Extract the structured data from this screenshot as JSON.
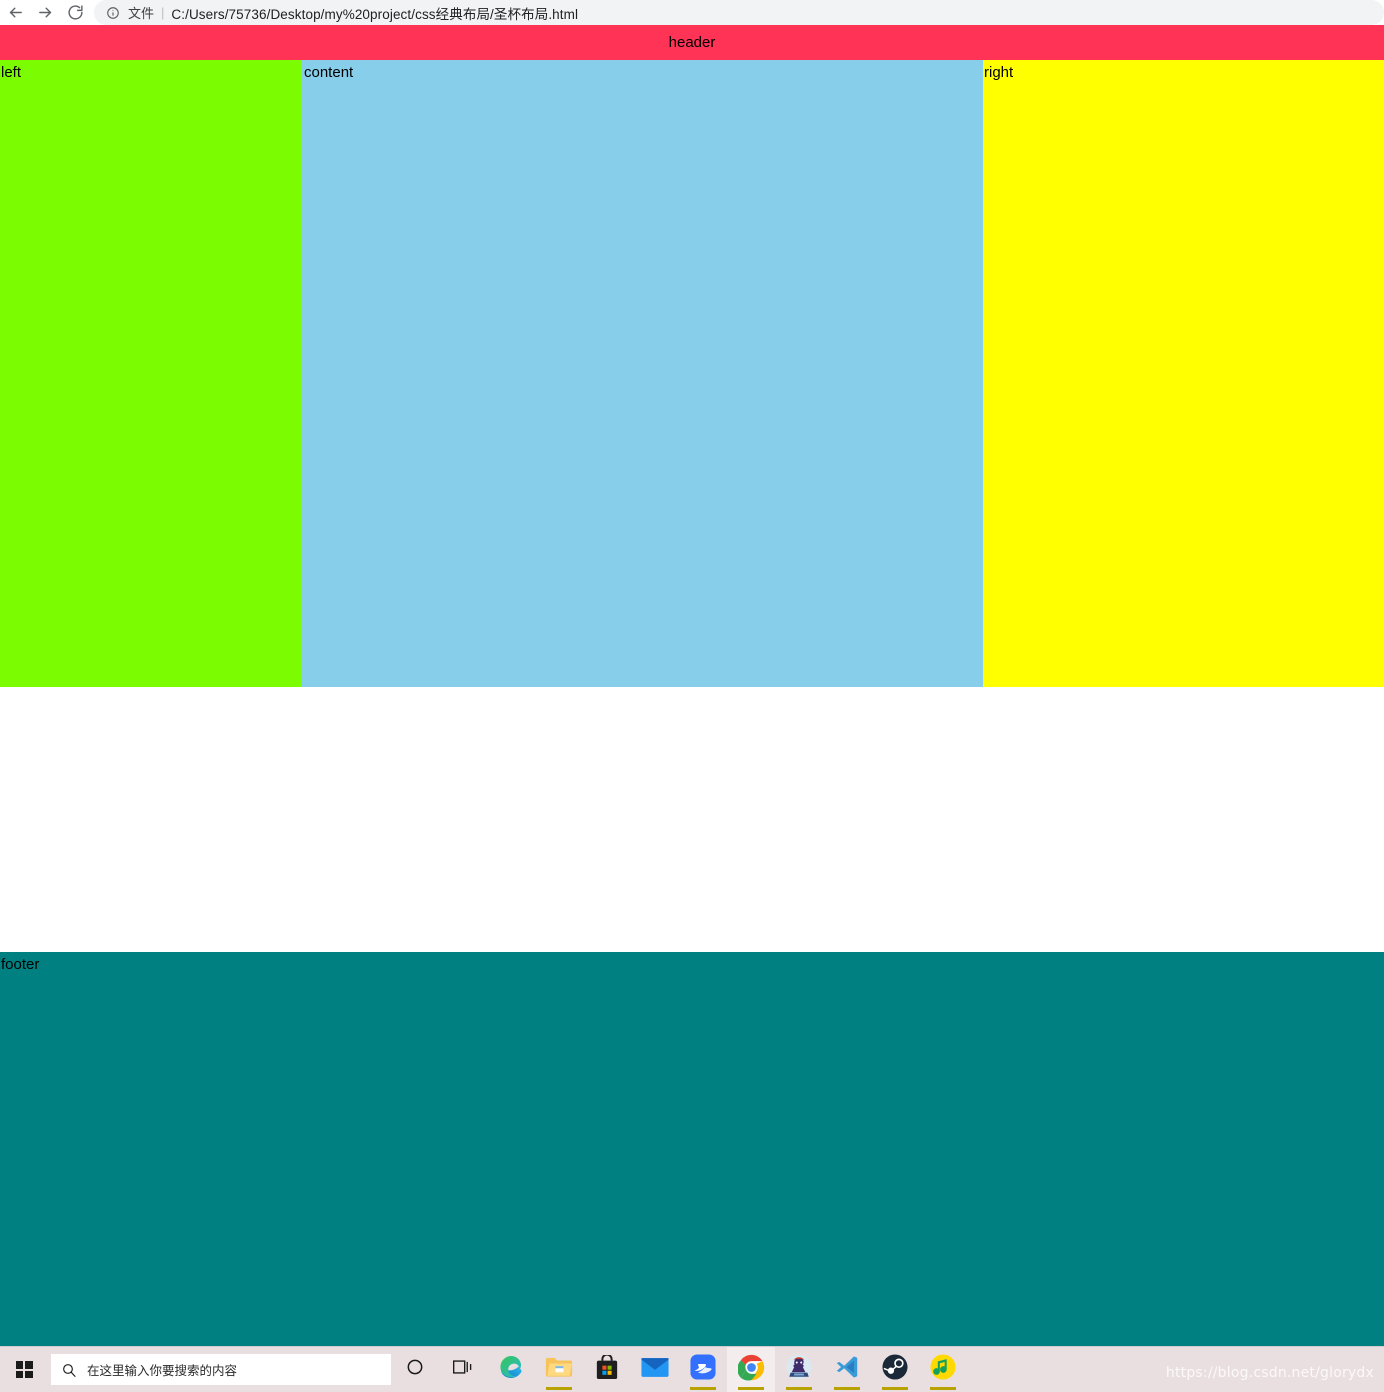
{
  "browser": {
    "back_icon": "back-arrow-icon",
    "forward_icon": "forward-arrow-icon",
    "reload_icon": "reload-icon",
    "site_info_icon": "info-circle-icon",
    "scheme_label": "文件",
    "separator": "|",
    "url": "C:/Users/75736/Desktop/my%20project/css经典布局/圣杯布局.html"
  },
  "page": {
    "header": {
      "label": "header",
      "color": "#FF3355"
    },
    "left": {
      "label": "left",
      "color": "#7CFC00"
    },
    "content": {
      "label": "content",
      "color": "#87CEEB"
    },
    "right": {
      "label": "right",
      "color": "#FFFF00"
    },
    "footer": {
      "label": "footer",
      "color": "#008080"
    }
  },
  "taskbar": {
    "start_icon": "windows-logo-icon",
    "search": {
      "icon": "search-icon",
      "placeholder": "在这里输入你要搜索的内容",
      "value": ""
    },
    "items": [
      {
        "name": "cortana-icon",
        "label": "Cortana"
      },
      {
        "name": "task-view-icon",
        "label": "任务视图"
      },
      {
        "name": "edge-icon",
        "label": "Microsoft Edge"
      },
      {
        "name": "file-explorer-icon",
        "label": "文件资源管理器"
      },
      {
        "name": "microsoft-store-icon",
        "label": "Microsoft Store"
      },
      {
        "name": "mail-icon",
        "label": "邮件"
      },
      {
        "name": "feishu-icon",
        "label": "飞书"
      },
      {
        "name": "chrome-icon",
        "label": "Google Chrome"
      },
      {
        "name": "game-app-icon",
        "label": "游戏"
      },
      {
        "name": "vscode-icon",
        "label": "Visual Studio Code"
      },
      {
        "name": "steam-icon",
        "label": "Steam"
      },
      {
        "name": "qq-music-icon",
        "label": "QQ音乐"
      }
    ],
    "watermark": "https://blog.csdn.net/glorydx"
  }
}
